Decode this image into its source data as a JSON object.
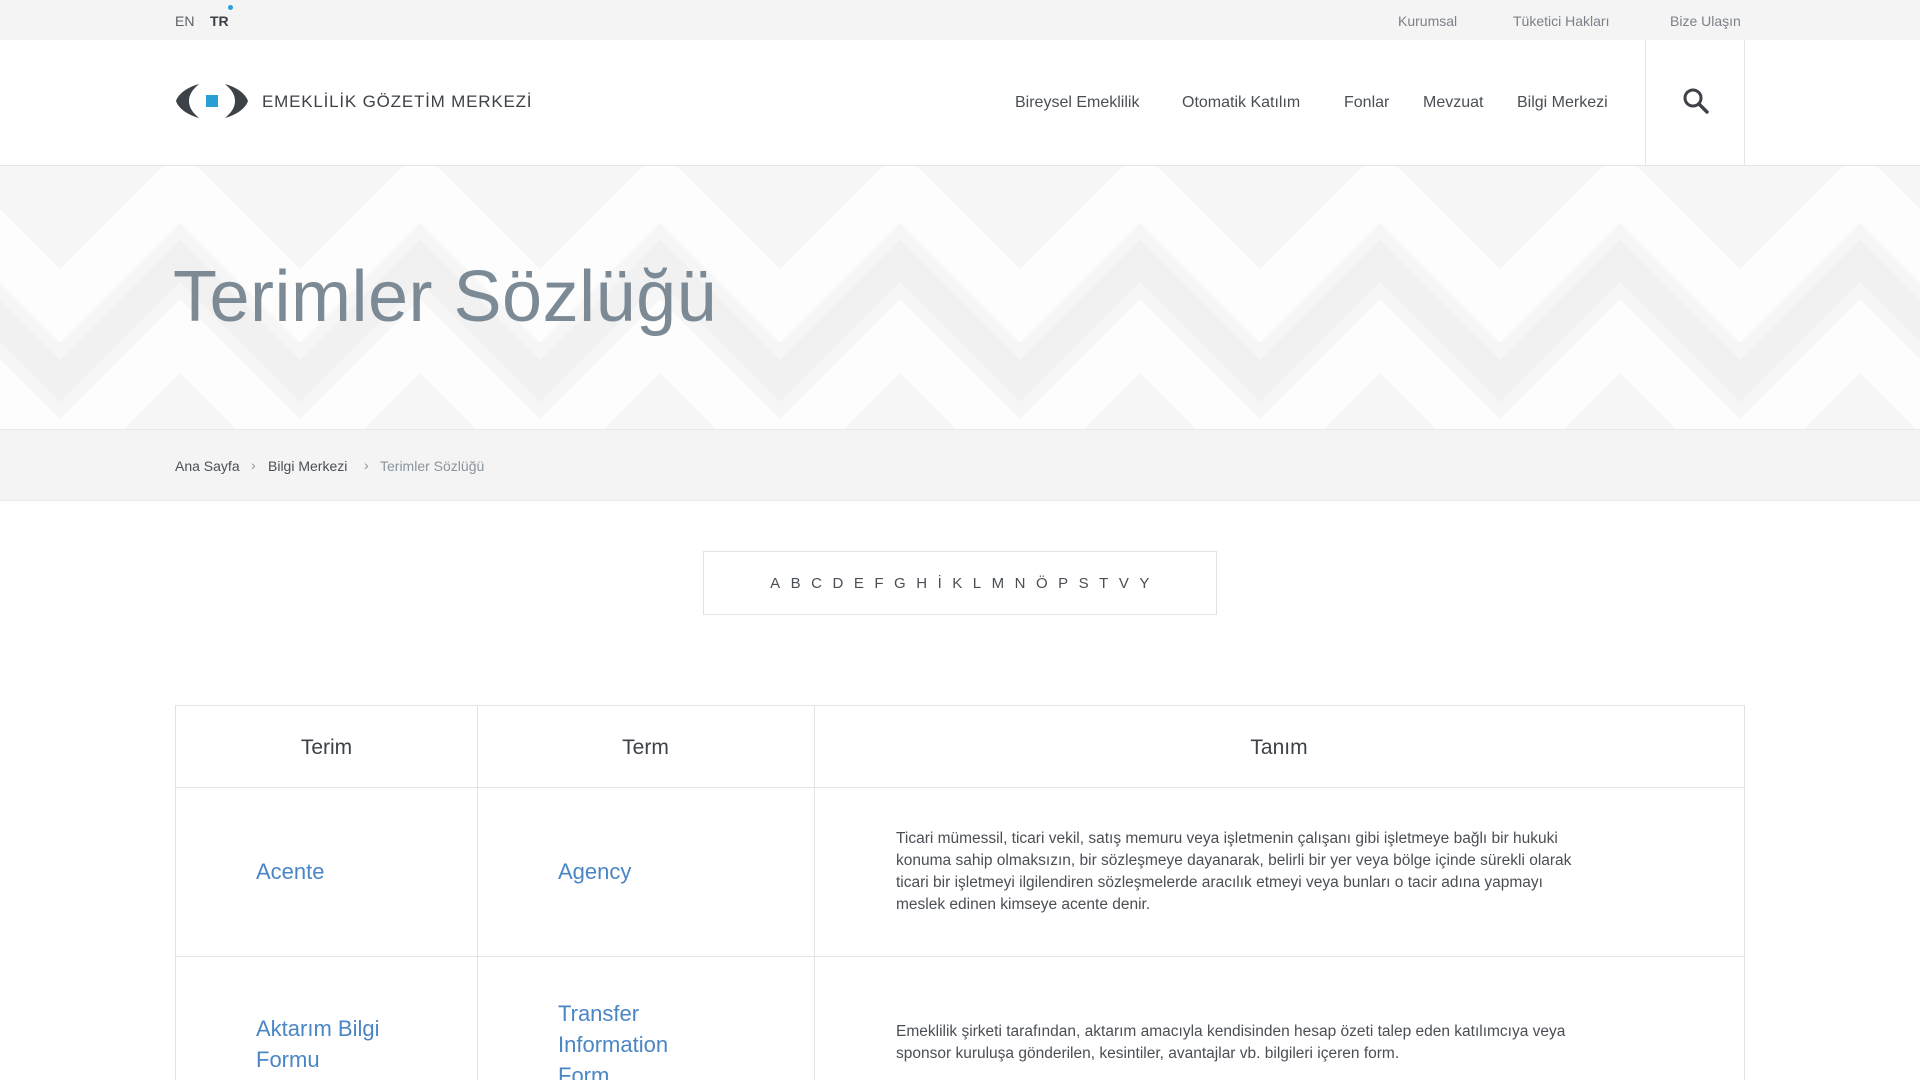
{
  "topbar": {
    "languages": [
      "EN",
      "TR"
    ],
    "links": [
      "Kurumsal",
      "Tüketici Hakları",
      "Bize Ulaşın"
    ]
  },
  "header": {
    "brand": "EMEKLİLİK GÖZETİM MERKEZİ",
    "nav": [
      "Bireysel Emeklilik",
      "Otomatik Katılım",
      "Fonlar",
      "Mevzuat",
      "Bilgi Merkezi"
    ],
    "search_icon": "search-icon"
  },
  "hero": {
    "title": "Terimler Sözlüğü"
  },
  "breadcrumb": {
    "items": [
      "Ana Sayfa",
      "Bilgi Merkezi",
      "Terimler Sözlüğü"
    ],
    "separator": "›"
  },
  "alphabet": [
    "A",
    "B",
    "C",
    "D",
    "E",
    "F",
    "G",
    "H",
    "İ",
    "K",
    "L",
    "M",
    "N",
    "Ö",
    "P",
    "S",
    "T",
    "V",
    "Y"
  ],
  "table": {
    "headers": [
      "Terim",
      "Term",
      "Tanım"
    ],
    "rows": [
      {
        "terim": "Acente",
        "term": "Agency",
        "tanim_lines": [
          "Ticari mümessil, ticari vekil, satış memuru veya işletmenin çalışanı gibi işletmeye bağlı bir hukuki",
          "konuma sahip olmaksızın, bir sözleşmeye dayanarak, belirli bir yer veya bölge içinde sürekli olarak",
          "ticari bir işletmeyi ilgilendiren sözleşmelerde aracılık etmeyi veya bunları o tacir adına yapmayı",
          "meslek edinen kimseye acente denir."
        ]
      },
      {
        "terim_lines": [
          "Aktarım Bilgi",
          "Formu"
        ],
        "term_lines": [
          "Transfer",
          "Information",
          "Form"
        ],
        "tanim_lines": [
          "Emeklilik şirketi tarafından, aktarım amacıyla kendisinden hesap özeti talep eden katılımcıya veya",
          "sponsor kuruluşa gönderilen, kesintiler, avantajlar vb. bilgileri içeren form."
        ]
      }
    ]
  },
  "colors": {
    "accent_blue": "#2a9fd6",
    "link_blue": "#4a86c5",
    "title_gray": "#7c8a96"
  }
}
